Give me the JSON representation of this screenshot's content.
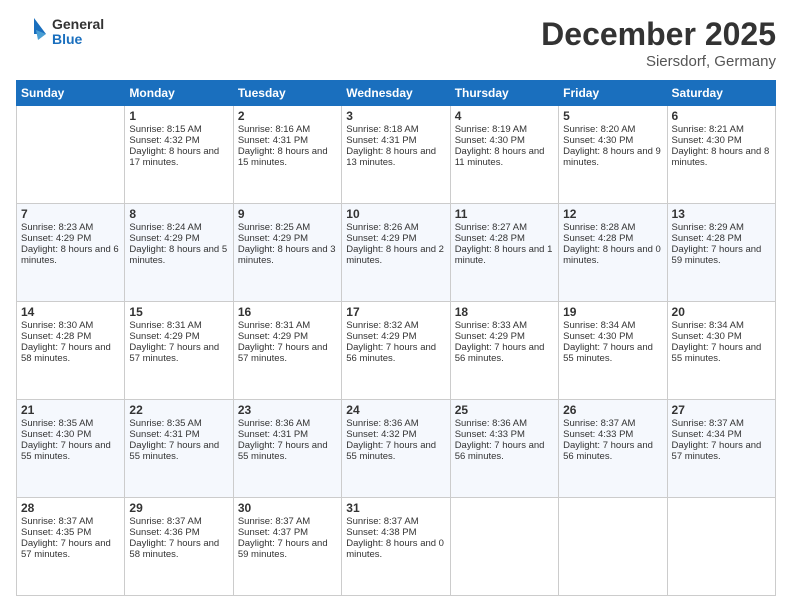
{
  "header": {
    "logo_line1": "General",
    "logo_line2": "Blue",
    "month": "December 2025",
    "location": "Siersdorf, Germany"
  },
  "days_of_week": [
    "Sunday",
    "Monday",
    "Tuesday",
    "Wednesday",
    "Thursday",
    "Friday",
    "Saturday"
  ],
  "weeks": [
    [
      {
        "day": "",
        "sunrise": "",
        "sunset": "",
        "daylight": ""
      },
      {
        "day": "1",
        "sunrise": "Sunrise: 8:15 AM",
        "sunset": "Sunset: 4:32 PM",
        "daylight": "Daylight: 8 hours and 17 minutes."
      },
      {
        "day": "2",
        "sunrise": "Sunrise: 8:16 AM",
        "sunset": "Sunset: 4:31 PM",
        "daylight": "Daylight: 8 hours and 15 minutes."
      },
      {
        "day": "3",
        "sunrise": "Sunrise: 8:18 AM",
        "sunset": "Sunset: 4:31 PM",
        "daylight": "Daylight: 8 hours and 13 minutes."
      },
      {
        "day": "4",
        "sunrise": "Sunrise: 8:19 AM",
        "sunset": "Sunset: 4:30 PM",
        "daylight": "Daylight: 8 hours and 11 minutes."
      },
      {
        "day": "5",
        "sunrise": "Sunrise: 8:20 AM",
        "sunset": "Sunset: 4:30 PM",
        "daylight": "Daylight: 8 hours and 9 minutes."
      },
      {
        "day": "6",
        "sunrise": "Sunrise: 8:21 AM",
        "sunset": "Sunset: 4:30 PM",
        "daylight": "Daylight: 8 hours and 8 minutes."
      }
    ],
    [
      {
        "day": "7",
        "sunrise": "Sunrise: 8:23 AM",
        "sunset": "Sunset: 4:29 PM",
        "daylight": "Daylight: 8 hours and 6 minutes."
      },
      {
        "day": "8",
        "sunrise": "Sunrise: 8:24 AM",
        "sunset": "Sunset: 4:29 PM",
        "daylight": "Daylight: 8 hours and 5 minutes."
      },
      {
        "day": "9",
        "sunrise": "Sunrise: 8:25 AM",
        "sunset": "Sunset: 4:29 PM",
        "daylight": "Daylight: 8 hours and 3 minutes."
      },
      {
        "day": "10",
        "sunrise": "Sunrise: 8:26 AM",
        "sunset": "Sunset: 4:29 PM",
        "daylight": "Daylight: 8 hours and 2 minutes."
      },
      {
        "day": "11",
        "sunrise": "Sunrise: 8:27 AM",
        "sunset": "Sunset: 4:28 PM",
        "daylight": "Daylight: 8 hours and 1 minute."
      },
      {
        "day": "12",
        "sunrise": "Sunrise: 8:28 AM",
        "sunset": "Sunset: 4:28 PM",
        "daylight": "Daylight: 8 hours and 0 minutes."
      },
      {
        "day": "13",
        "sunrise": "Sunrise: 8:29 AM",
        "sunset": "Sunset: 4:28 PM",
        "daylight": "Daylight: 7 hours and 59 minutes."
      }
    ],
    [
      {
        "day": "14",
        "sunrise": "Sunrise: 8:30 AM",
        "sunset": "Sunset: 4:28 PM",
        "daylight": "Daylight: 7 hours and 58 minutes."
      },
      {
        "day": "15",
        "sunrise": "Sunrise: 8:31 AM",
        "sunset": "Sunset: 4:29 PM",
        "daylight": "Daylight: 7 hours and 57 minutes."
      },
      {
        "day": "16",
        "sunrise": "Sunrise: 8:31 AM",
        "sunset": "Sunset: 4:29 PM",
        "daylight": "Daylight: 7 hours and 57 minutes."
      },
      {
        "day": "17",
        "sunrise": "Sunrise: 8:32 AM",
        "sunset": "Sunset: 4:29 PM",
        "daylight": "Daylight: 7 hours and 56 minutes."
      },
      {
        "day": "18",
        "sunrise": "Sunrise: 8:33 AM",
        "sunset": "Sunset: 4:29 PM",
        "daylight": "Daylight: 7 hours and 56 minutes."
      },
      {
        "day": "19",
        "sunrise": "Sunrise: 8:34 AM",
        "sunset": "Sunset: 4:30 PM",
        "daylight": "Daylight: 7 hours and 55 minutes."
      },
      {
        "day": "20",
        "sunrise": "Sunrise: 8:34 AM",
        "sunset": "Sunset: 4:30 PM",
        "daylight": "Daylight: 7 hours and 55 minutes."
      }
    ],
    [
      {
        "day": "21",
        "sunrise": "Sunrise: 8:35 AM",
        "sunset": "Sunset: 4:30 PM",
        "daylight": "Daylight: 7 hours and 55 minutes."
      },
      {
        "day": "22",
        "sunrise": "Sunrise: 8:35 AM",
        "sunset": "Sunset: 4:31 PM",
        "daylight": "Daylight: 7 hours and 55 minutes."
      },
      {
        "day": "23",
        "sunrise": "Sunrise: 8:36 AM",
        "sunset": "Sunset: 4:31 PM",
        "daylight": "Daylight: 7 hours and 55 minutes."
      },
      {
        "day": "24",
        "sunrise": "Sunrise: 8:36 AM",
        "sunset": "Sunset: 4:32 PM",
        "daylight": "Daylight: 7 hours and 55 minutes."
      },
      {
        "day": "25",
        "sunrise": "Sunrise: 8:36 AM",
        "sunset": "Sunset: 4:33 PM",
        "daylight": "Daylight: 7 hours and 56 minutes."
      },
      {
        "day": "26",
        "sunrise": "Sunrise: 8:37 AM",
        "sunset": "Sunset: 4:33 PM",
        "daylight": "Daylight: 7 hours and 56 minutes."
      },
      {
        "day": "27",
        "sunrise": "Sunrise: 8:37 AM",
        "sunset": "Sunset: 4:34 PM",
        "daylight": "Daylight: 7 hours and 57 minutes."
      }
    ],
    [
      {
        "day": "28",
        "sunrise": "Sunrise: 8:37 AM",
        "sunset": "Sunset: 4:35 PM",
        "daylight": "Daylight: 7 hours and 57 minutes."
      },
      {
        "day": "29",
        "sunrise": "Sunrise: 8:37 AM",
        "sunset": "Sunset: 4:36 PM",
        "daylight": "Daylight: 7 hours and 58 minutes."
      },
      {
        "day": "30",
        "sunrise": "Sunrise: 8:37 AM",
        "sunset": "Sunset: 4:37 PM",
        "daylight": "Daylight: 7 hours and 59 minutes."
      },
      {
        "day": "31",
        "sunrise": "Sunrise: 8:37 AM",
        "sunset": "Sunset: 4:38 PM",
        "daylight": "Daylight: 8 hours and 0 minutes."
      },
      {
        "day": "",
        "sunrise": "",
        "sunset": "",
        "daylight": ""
      },
      {
        "day": "",
        "sunrise": "",
        "sunset": "",
        "daylight": ""
      },
      {
        "day": "",
        "sunrise": "",
        "sunset": "",
        "daylight": ""
      }
    ]
  ]
}
